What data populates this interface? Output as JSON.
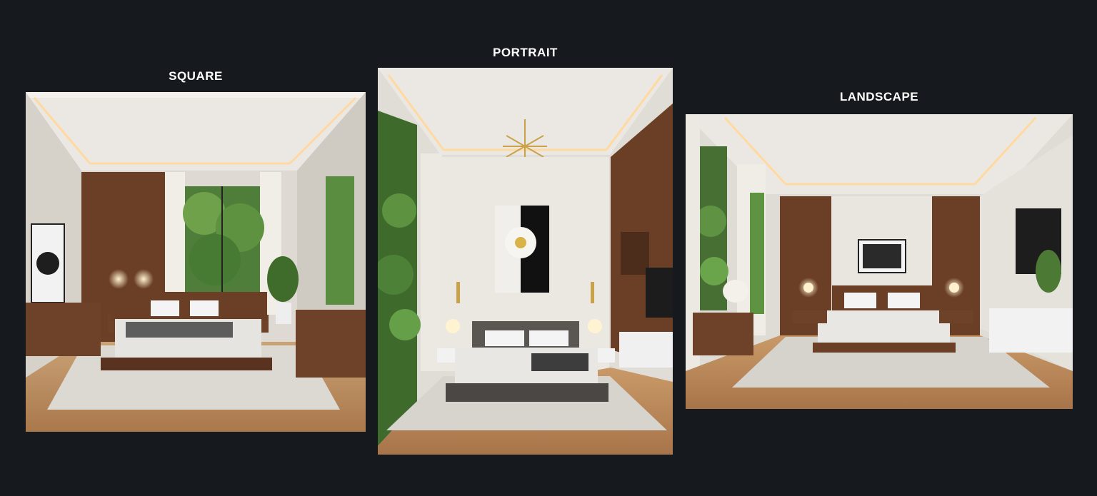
{
  "panels": [
    {
      "id": "square",
      "label": "SQUARE"
    },
    {
      "id": "portrait",
      "label": "PORTRAIT"
    },
    {
      "id": "landscape",
      "label": "LANDSCAPE"
    }
  ],
  "colors": {
    "background": "#16191e",
    "label": "#ffffff",
    "walnut": "#6b3f26",
    "ceiling": "#e9e6e1",
    "floor": "#b98a5c",
    "led": "#ffd9a0"
  }
}
